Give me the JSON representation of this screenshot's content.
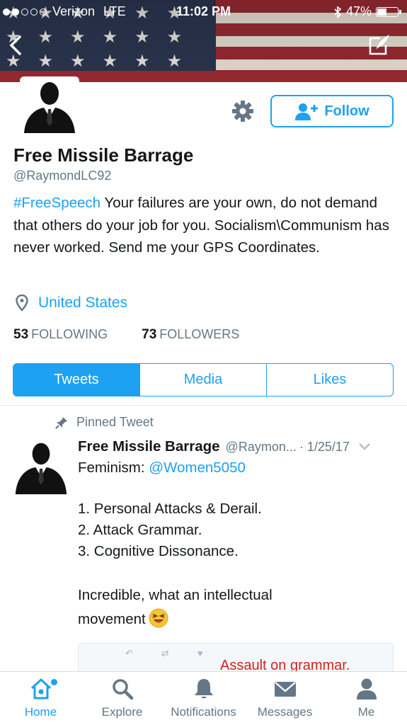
{
  "status_bar": {
    "carrier": "Verizon",
    "network": "LTE",
    "time": "11:02 PM",
    "battery": "47%",
    "battery_level": 0.47
  },
  "profile": {
    "name": "Free Missile Barrage",
    "handle": "@RaymondLC92",
    "bio_hashtag": "#FreeSpeech",
    "bio_text": " Your failures are your own, do not demand that others do your job for you. Socialism\\Communism has never worked. Send me your GPS Coordinates.",
    "location": "United States",
    "following_count": "53",
    "following_label": "FOLLOWING",
    "followers_count": "73",
    "followers_label": "FOLLOWERS",
    "follow_label": "Follow"
  },
  "tabs": [
    "Tweets",
    "Media",
    "Likes"
  ],
  "tweet": {
    "pinned_label": "Pinned Tweet",
    "name": "Free Missile Barrage",
    "handle": "@Raymon...",
    "date": "· 1/25/17",
    "line1_text": "Feminism: ",
    "line1_mention": "@Women5050",
    "list": [
      "1. Personal Attacks & Derail.",
      "2. Attack Grammar.",
      "3. Cognitive Dissonance."
    ],
    "closing_line1": "Incredible, what an intellectual",
    "closing_line2": "movement",
    "embed_caption": "Assault on grammar."
  },
  "tabbar": [
    {
      "label": "Home",
      "icon": "home-icon"
    },
    {
      "label": "Explore",
      "icon": "search-icon"
    },
    {
      "label": "Notifications",
      "icon": "bell-icon"
    },
    {
      "label": "Messages",
      "icon": "envelope-icon"
    },
    {
      "label": "Me",
      "icon": "person-icon"
    }
  ],
  "colors": {
    "accent": "#1da1f2",
    "text": "#14171a",
    "muted": "#657786",
    "embed_caption": "#d0241c"
  }
}
